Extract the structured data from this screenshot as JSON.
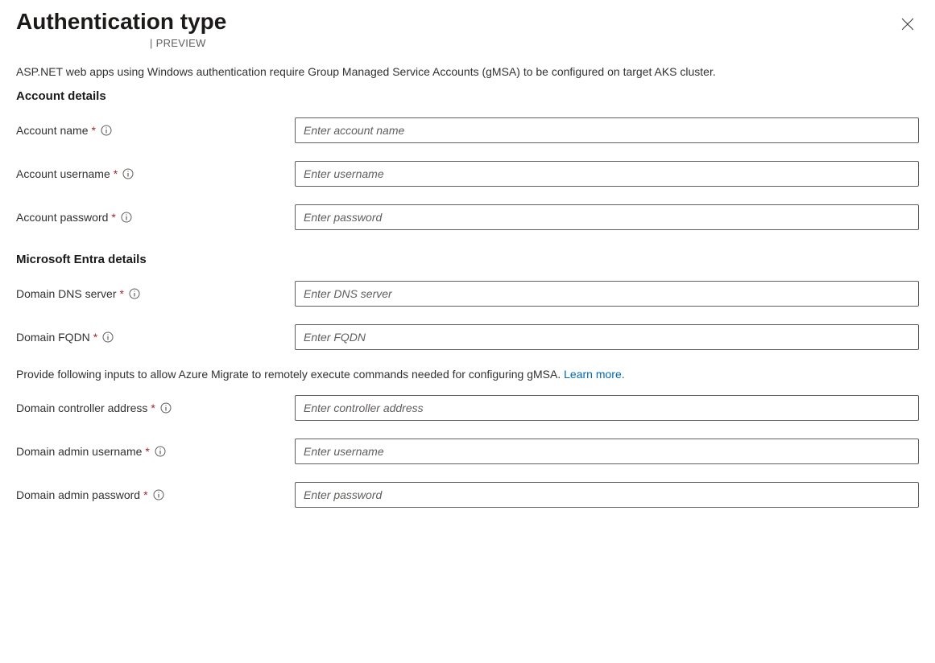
{
  "header": {
    "title": "Authentication type",
    "preview_prefix": "| ",
    "preview": "PREVIEW"
  },
  "description": "ASP.NET web apps using Windows authentication require Group Managed Service Accounts (gMSA) to be configured on target AKS cluster.",
  "sections": {
    "account": {
      "heading": "Account details",
      "fields": {
        "name": {
          "label": "Account name",
          "placeholder": "Enter account name"
        },
        "username": {
          "label": "Account username",
          "placeholder": "Enter username"
        },
        "password": {
          "label": "Account password",
          "placeholder": "Enter password"
        }
      }
    },
    "entra": {
      "heading": "Microsoft Entra details",
      "fields": {
        "dns": {
          "label": "Domain DNS server",
          "placeholder": "Enter DNS server"
        },
        "fqdn": {
          "label": "Domain FQDN",
          "placeholder": "Enter FQDN"
        },
        "controller": {
          "label": "Domain controller address",
          "placeholder": "Enter controller address"
        },
        "admin_user": {
          "label": "Domain admin username",
          "placeholder": "Enter username"
        },
        "admin_pass": {
          "label": "Domain admin password",
          "placeholder": "Enter password"
        }
      },
      "helper_text": "Provide following inputs to allow Azure Migrate to remotely execute commands needed for configuring gMSA. ",
      "learn_more": "Learn more."
    }
  },
  "required_marker": "*"
}
